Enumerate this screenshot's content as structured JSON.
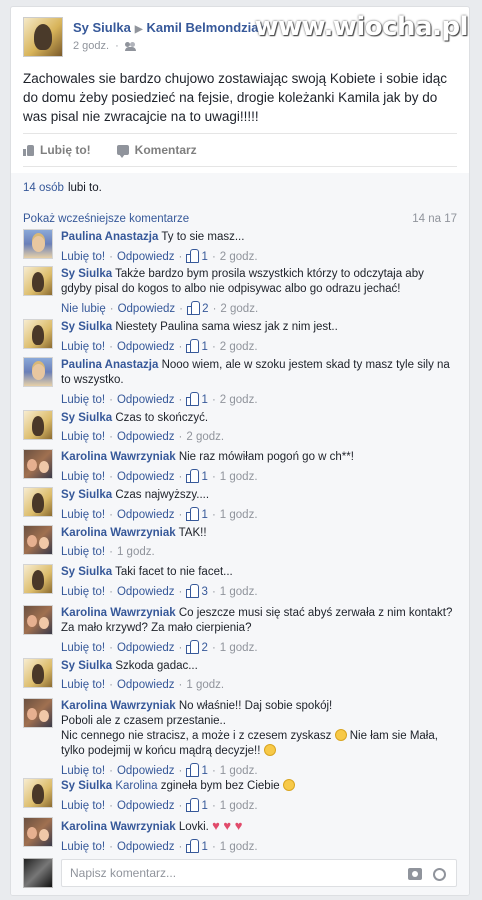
{
  "watermark": "www.wiocha.pl",
  "post": {
    "author": "Sy Siulka",
    "arrow": "▶",
    "target": "Kamil Belmondziak",
    "time": "2 godz.",
    "text": "Zachowales sie bardzo chujowo zostawiając swoją Kobiete i sobie idąc do domu żeby posiedzieć na fejsie, drogie koleżanki Kamila jak by do was pisal nie zwracajcie na to uwagi!!!!!"
  },
  "actions": {
    "like": "Lubię to!",
    "comment": "Komentarz"
  },
  "likes": {
    "count_link": "14 osób",
    "suffix": "lubi to."
  },
  "comments_header": {
    "prev": "Pokaż wcześniejsze komentarze",
    "count": "14 na 17"
  },
  "comments": [
    {
      "avatar": "pa",
      "author": "Paulina Anastazja",
      "text": "Ty to sie masz...",
      "like_label": "Lubię to!",
      "reply": "Odpowiedz",
      "likes": "1",
      "time": "2 godz."
    },
    {
      "avatar": "sy",
      "author": "Sy Siulka",
      "text": "Także bardzo bym prosila wszystkich którzy to odczytaja aby gdyby pisal do kogos to albo nie odpisywac albo go odrazu jechać!",
      "like_label": "Nie lubię",
      "reply": "Odpowiedz",
      "likes": "2",
      "time": "2 godz."
    },
    {
      "avatar": "sy",
      "author": "Sy Siulka",
      "text": "Niestety Paulina sama wiesz jak z nim jest..",
      "like_label": "Lubię to!",
      "reply": "Odpowiedz",
      "likes": "1",
      "time": "2 godz."
    },
    {
      "avatar": "pa",
      "author": "Paulina Anastazja",
      "text": "Nooo wiem, ale w szoku jestem skad ty masz tyle sily na to wszystko.",
      "like_label": "Lubię to!",
      "reply": "Odpowiedz",
      "likes": "1",
      "time": "2 godz."
    },
    {
      "avatar": "sy",
      "author": "Sy Siulka",
      "text": "Czas to skończyć.",
      "like_label": "Lubię to!",
      "reply": "Odpowiedz",
      "likes": "",
      "time": "2 godz."
    },
    {
      "avatar": "ka",
      "author": "Karolina Wawrzyniak",
      "text": "Nie raz mówiłam pogoń go w ch**!",
      "like_label": "Lubię to!",
      "reply": "Odpowiedz",
      "likes": "1",
      "time": "1 godz."
    },
    {
      "avatar": "sy",
      "author": "Sy Siulka",
      "text": "Czas najwyższy....",
      "like_label": "Lubię to!",
      "reply": "Odpowiedz",
      "likes": "1",
      "time": "1 godz."
    },
    {
      "avatar": "ka",
      "author": "Karolina Wawrzyniak",
      "text": "TAK!!",
      "like_label": "Lubię to!",
      "reply": "",
      "likes": "",
      "time": "1 godz."
    },
    {
      "avatar": "sy",
      "author": "Sy Siulka",
      "text": "Taki facet to nie facet...",
      "like_label": "Lubię to!",
      "reply": "Odpowiedz",
      "likes": "3",
      "time": "1 godz."
    },
    {
      "avatar": "ka",
      "author": "Karolina Wawrzyniak",
      "text": "Co jeszcze musi się stać abyś zerwała z nim kontakt? Za mało krzywd? Za mało cierpienia?",
      "like_label": "Lubię to!",
      "reply": "Odpowiedz",
      "likes": "2",
      "time": "1 godz."
    },
    {
      "avatar": "sy",
      "author": "Sy Siulka",
      "text": "Szkoda gadac...",
      "like_label": "Lubię to!",
      "reply": "Odpowiedz",
      "likes": "",
      "time": "1 godz."
    },
    {
      "avatar": "ka",
      "author": "Karolina Wawrzyniak",
      "text": "No właśnie!! Daj sobie spokój!",
      "text2": "Poboli ale z czasem przestanie..",
      "text3": "Nic cennego nie stracisz, a może i z czesem zyskasz",
      "text4": "Nie łam sie Mała, tylko podejmij w końcu mądrą decyzje!!",
      "like_label": "Lubię to!",
      "reply": "Odpowiedz",
      "likes": "1",
      "time": "1 godz."
    },
    {
      "avatar": "sy",
      "author": "Sy Siulka",
      "mention": "Karolina",
      "text": "zgineła bym bez Ciebie",
      "like_label": "Lubię to!",
      "reply": "Odpowiedz",
      "likes": "1",
      "time": "1 godz."
    },
    {
      "avatar": "ka",
      "author": "Karolina Wawrzyniak",
      "text": "Lovki.",
      "like_label": "Lubię to!",
      "reply": "Odpowiedz",
      "likes": "1",
      "time": "1 godz."
    }
  ],
  "reply": {
    "placeholder": "Napisz komentarz..."
  }
}
